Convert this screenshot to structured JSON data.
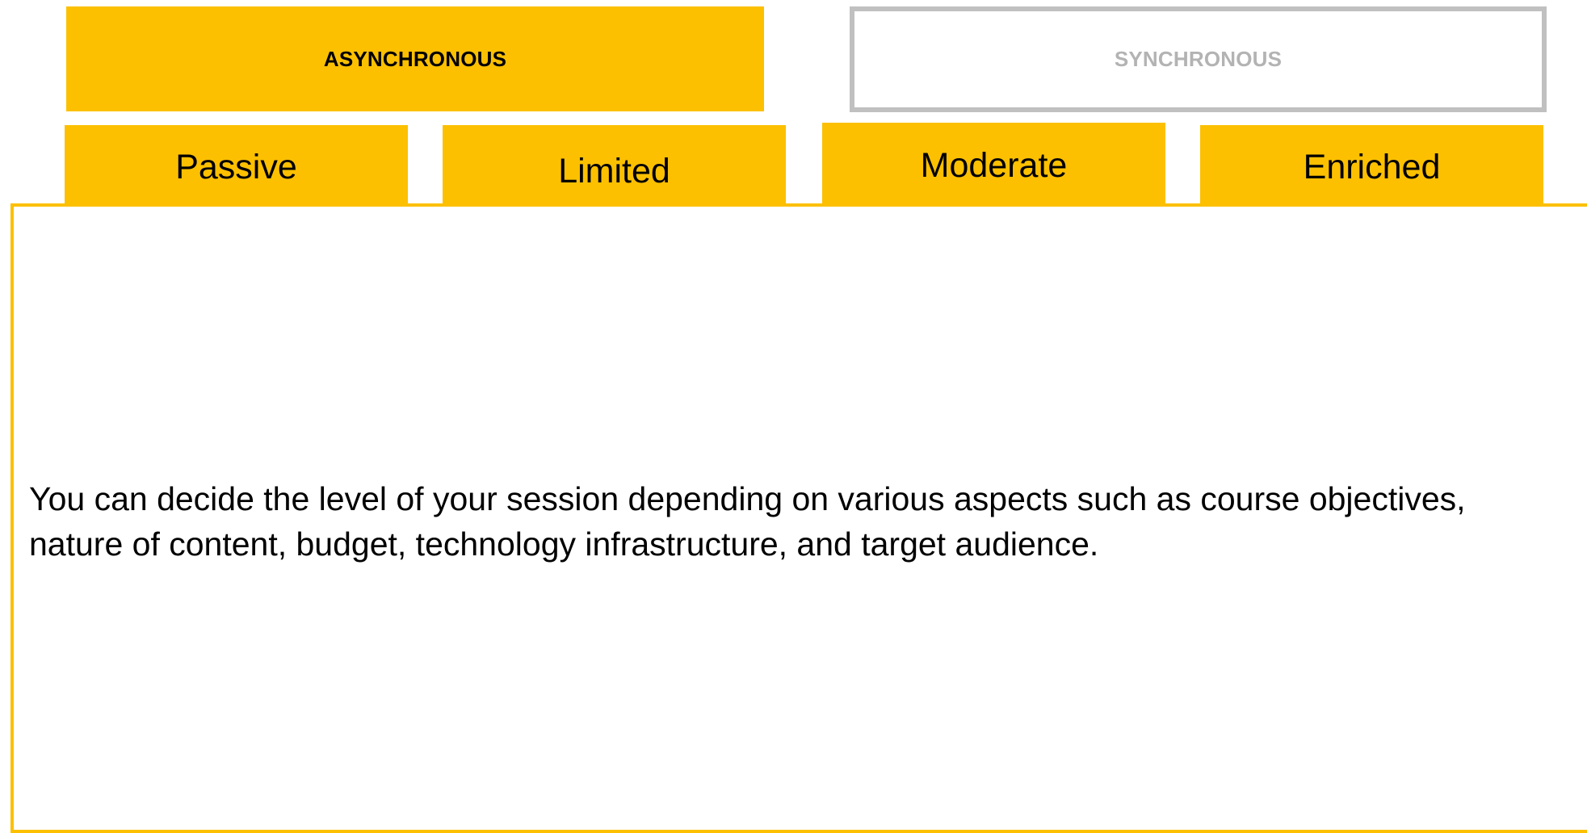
{
  "modes": {
    "asynchronous_label": "ASYNCHRONOUS",
    "synchronous_label": "SYNCHRONOUS",
    "active_color": "#fcc000",
    "inactive_border_color": "#c0c0c0"
  },
  "levels": [
    {
      "label": "Passive"
    },
    {
      "label": "Limited"
    },
    {
      "label": "Moderate"
    },
    {
      "label": "Enriched"
    }
  ],
  "content": {
    "text": "You can decide the level of your session depending on various aspects such as course objectives, nature of content, budget, technology infrastructure, and target audience."
  }
}
